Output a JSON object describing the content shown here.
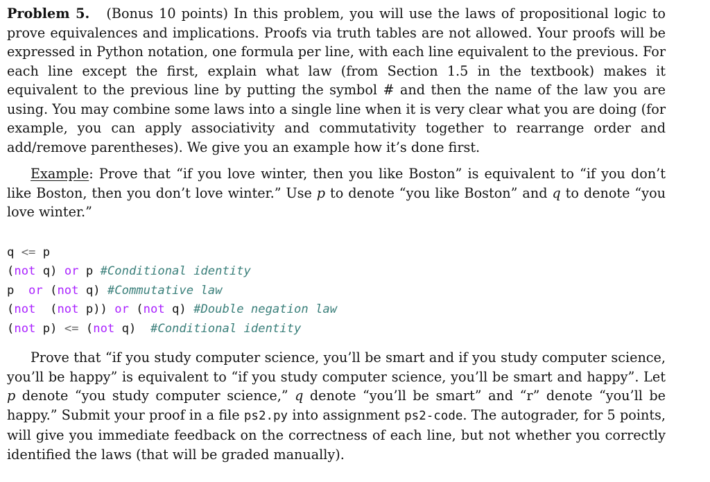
{
  "problem": {
    "label": "Problem 5.",
    "intro_segments": [
      "(Bonus 10 points) In this problem, you will use the laws of propositional logic to prove equivalences and implications. Proofs via truth tables are not allowed. Your proofs will be expressed in Python notation, one formula per line, with each line equivalent to the previous. For each line except the first, explain what law (from Section 1.5 in the textbook) makes it equivalent to the previous line by putting the symbol # and then the name of the law you are using. You may combine some laws into a single line when it is very clear what you are doing (for example, you can apply associativity and commutativity together to rearrange order and add/remove parentheses). We give you an example how it’s done first."
    ]
  },
  "example": {
    "label": "Example",
    "text_1": ": Prove that “if you love winter, then you like Boston” is equivalent to “if you don’t like Boston, then you don’t love winter.” Use ",
    "var_p": "p",
    "text_2": " to denote “you like Boston” and ",
    "var_q": "q",
    "text_3": " to denote “you love winter.”"
  },
  "code": {
    "keyword_color": "#aa22ff",
    "comment_color": "#3a7f7a",
    "lines": [
      [
        {
          "t": "q ",
          "c": ""
        },
        {
          "t": "<=",
          "c": "op"
        },
        {
          "t": " p",
          "c": ""
        }
      ],
      [
        {
          "t": "(",
          "c": ""
        },
        {
          "t": "not",
          "c": "kw"
        },
        {
          "t": " q) ",
          "c": ""
        },
        {
          "t": "or",
          "c": "kw"
        },
        {
          "t": " p ",
          "c": ""
        },
        {
          "t": "#Conditional identity",
          "c": "cm"
        }
      ],
      [
        {
          "t": "p  ",
          "c": ""
        },
        {
          "t": "or",
          "c": "kw"
        },
        {
          "t": " (",
          "c": ""
        },
        {
          "t": "not",
          "c": "kw"
        },
        {
          "t": " q) ",
          "c": ""
        },
        {
          "t": "#Commutative law",
          "c": "cm"
        }
      ],
      [
        {
          "t": "(",
          "c": ""
        },
        {
          "t": "not",
          "c": "kw"
        },
        {
          "t": "  (",
          "c": ""
        },
        {
          "t": "not",
          "c": "kw"
        },
        {
          "t": " p)) ",
          "c": ""
        },
        {
          "t": "or",
          "c": "kw"
        },
        {
          "t": " (",
          "c": ""
        },
        {
          "t": "not",
          "c": "kw"
        },
        {
          "t": " q) ",
          "c": ""
        },
        {
          "t": "#Double negation law",
          "c": "cm"
        }
      ],
      [
        {
          "t": "(",
          "c": ""
        },
        {
          "t": "not",
          "c": "kw"
        },
        {
          "t": " p) ",
          "c": ""
        },
        {
          "t": "<=",
          "c": "op"
        },
        {
          "t": " (",
          "c": ""
        },
        {
          "t": "not",
          "c": "kw"
        },
        {
          "t": " q)  ",
          "c": ""
        },
        {
          "t": "#Conditional identity",
          "c": "cm"
        }
      ]
    ]
  },
  "task": {
    "text_1": "Prove that “if you study computer science, you’ll be smart and if you study computer science, you’ll be happy” is equivalent to “if you study computer science, you’ll be smart and happy”. Let ",
    "var_p": "p",
    "text_2": " denote “you study computer science,” ",
    "var_q": "q",
    "text_3": " denote “you’ll be smart” and “r” denote “you’ll be happy.” Submit your proof in a file ",
    "file_name": "ps2.py",
    "text_4": " into assignment ",
    "assignment_name": "ps2-code",
    "text_5": ". The autograder, for 5 points, will give you immediate feedback on the correctness of each line, but not whether you correctly identified the laws (that will be graded manually)."
  }
}
